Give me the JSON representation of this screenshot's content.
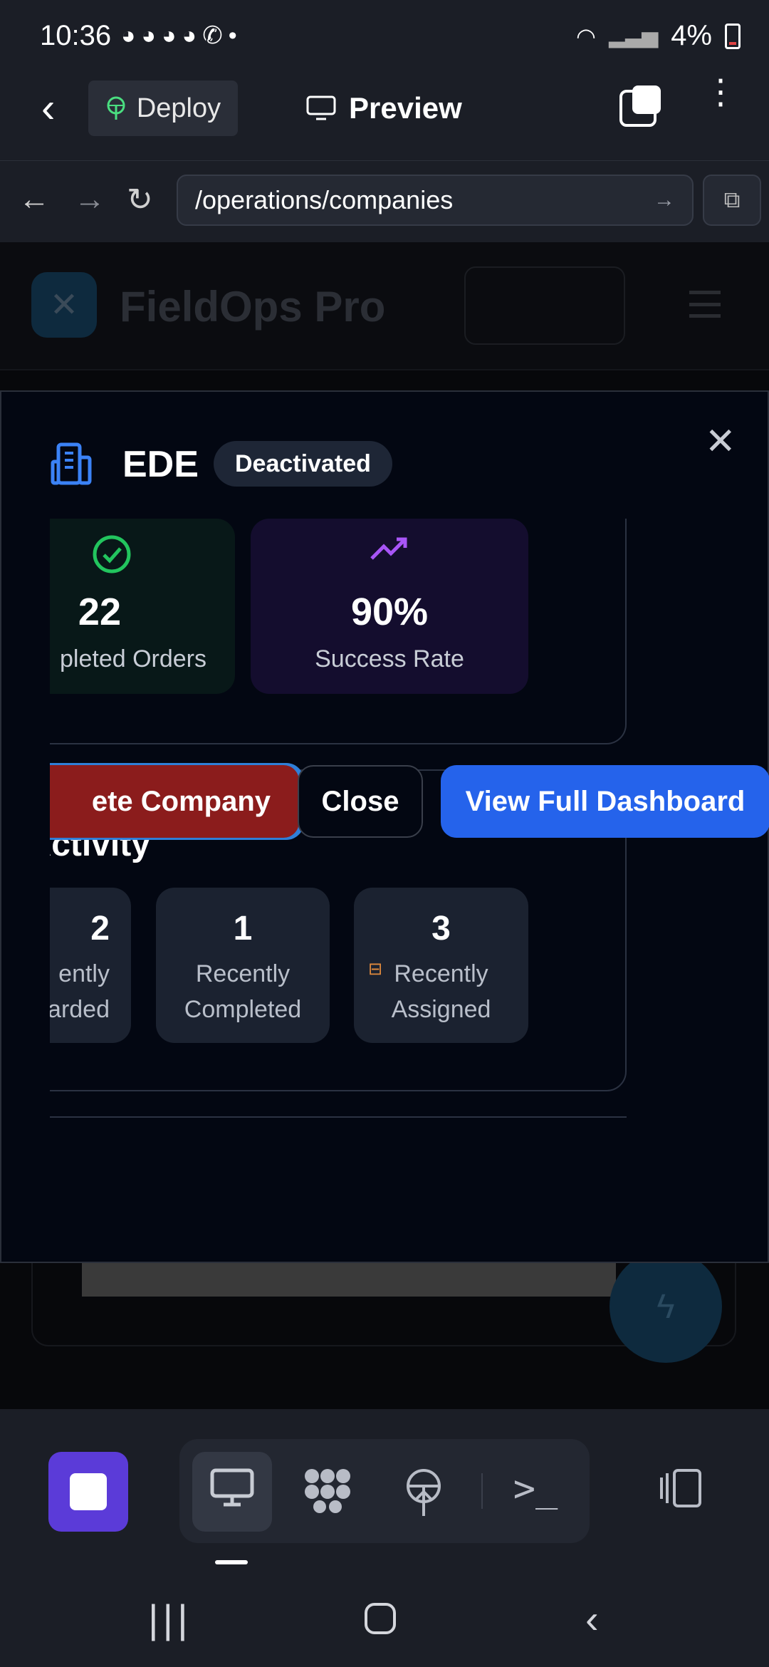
{
  "status_bar": {
    "time": "10:36",
    "notification_icons": [
      "messenger-icon",
      "messenger-icon",
      "messenger-icon",
      "messenger-icon",
      "missed-call-icon",
      "dot-icon"
    ],
    "battery": "4%"
  },
  "app_bar": {
    "deploy_label": "Deploy",
    "preview_label": "Preview"
  },
  "browser": {
    "url": "/operations/companies"
  },
  "page": {
    "app_name": "FieldOps Pro"
  },
  "modal": {
    "company_name": "EDE",
    "status": "Deactivated",
    "stats": [
      {
        "value": "22",
        "label": "Completed Orders",
        "visible_label": "pleted Orders",
        "icon": "check-circle-icon",
        "color": "#22c55e"
      },
      {
        "value": "90%",
        "label": "Success Rate",
        "icon": "trending-up-icon",
        "color": "#a855f7"
      }
    ],
    "activity_title": "Recent Activity",
    "activity_title_visible": "t Activity",
    "activity": [
      {
        "value": "2",
        "visible_value": "2",
        "line1": "ently",
        "line2": "arded"
      },
      {
        "value": "1",
        "line1": "Recently",
        "line2": "Completed"
      },
      {
        "value": "3",
        "line1": "Recently",
        "line2": "Assigned",
        "icon": "briefcase-icon"
      }
    ],
    "buttons": {
      "delete": "ete Company",
      "close": "Close",
      "view": "View Full Dashboard"
    }
  },
  "colors": {
    "primary": "#2563eb",
    "danger": "#8b1c1c",
    "accent_purple": "#5b3bd8",
    "success": "#22c55e"
  }
}
